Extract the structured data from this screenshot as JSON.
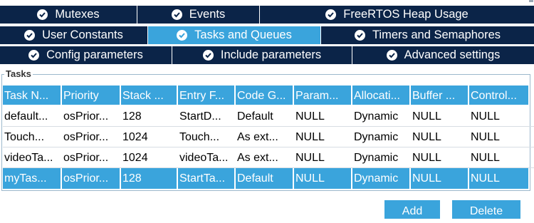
{
  "tabs": {
    "row1": [
      {
        "label": "Mutexes",
        "active": false
      },
      {
        "label": "Events",
        "active": false
      },
      {
        "label": "FreeRTOS Heap Usage",
        "active": false
      }
    ],
    "row2": [
      {
        "label": "User Constants",
        "active": false
      },
      {
        "label": "Tasks and Queues",
        "active": true
      },
      {
        "label": "Timers and Semaphores",
        "active": false
      }
    ],
    "row3": [
      {
        "label": "Config parameters",
        "active": false
      },
      {
        "label": "Include parameters",
        "active": false
      },
      {
        "label": "Advanced settings",
        "active": false
      }
    ]
  },
  "tasks": {
    "group_label": "Tasks",
    "columns": [
      "Task N...",
      "Priority",
      "Stack ...",
      "Entry F...",
      "Code G...",
      "Param...",
      "Allocati...",
      "Buffer ...",
      "Control..."
    ],
    "rows": [
      [
        "default...",
        "osPrior...",
        "128",
        "StartD...",
        "Default",
        "NULL",
        "Dynamic",
        "NULL",
        "NULL"
      ],
      [
        "Touch...",
        "osPrior...",
        "1024",
        "Touch...",
        "As ext...",
        "NULL",
        "Dynamic",
        "NULL",
        "NULL"
      ],
      [
        "videoTa...",
        "osPrior...",
        "1024",
        "videoTa...",
        "As ext...",
        "NULL",
        "Dynamic",
        "NULL",
        "NULL"
      ],
      [
        "myTas...",
        "osPrior...",
        "128",
        "StartTa...",
        "Default",
        "NULL",
        "Dynamic",
        "NULL",
        "NULL"
      ]
    ],
    "selected_row": 3
  },
  "buttons": {
    "add": "Add",
    "delete": "Delete"
  },
  "colors": {
    "tab_dark": "#0b2448",
    "accent": "#3aa4dc"
  }
}
